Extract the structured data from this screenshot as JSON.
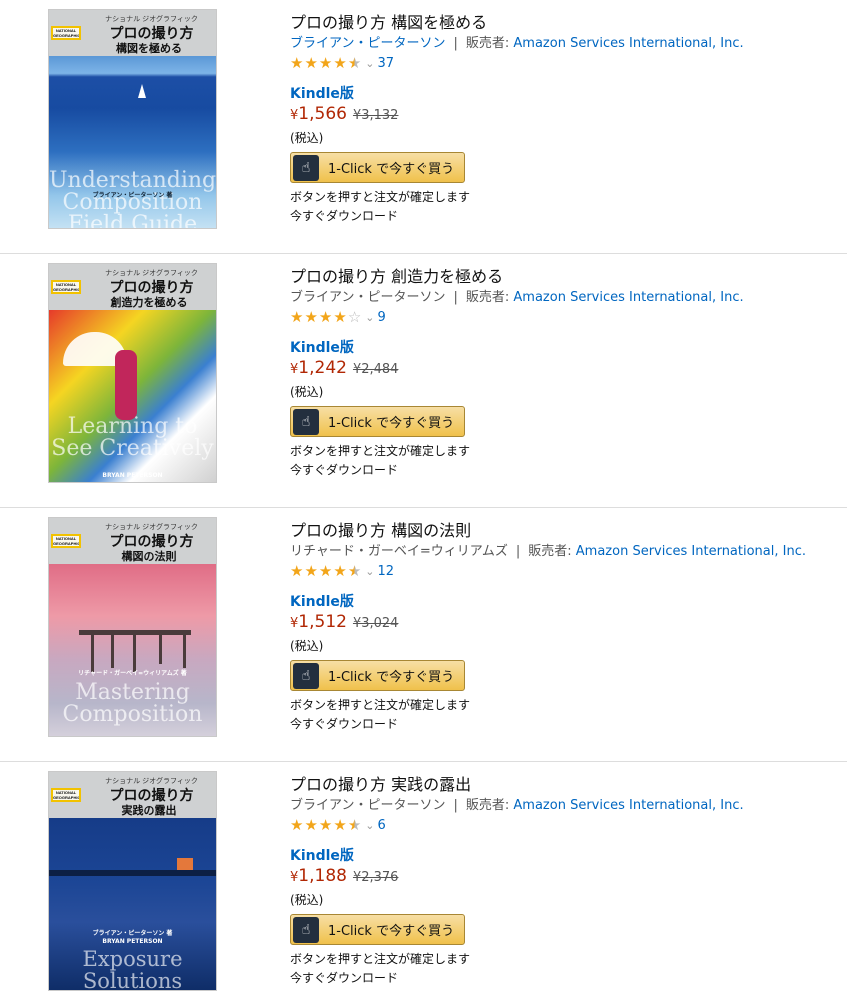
{
  "items": [
    {
      "title": "プロの撮り方 構図を極める",
      "author": "ブライアン・ピーターソン",
      "author_is_link": true,
      "seller_prefix": "販売者:",
      "seller": "Amazon Services International, Inc.",
      "stars": 4.5,
      "review_count": "37",
      "format": "Kindle版",
      "price": "1,566",
      "list_price": "¥3,132",
      "tax_note": "(税込)",
      "buy_label": "1-Click で今すぐ買う",
      "note": "ボタンを押すと注文が確定します",
      "download": "今すぐダウンロード",
      "cover": {
        "logo": "NATIONAL GEOGRAPHIC",
        "series_sub": "ナショナル ジオグラフィック",
        "series_main": "プロの撮り方",
        "subtitle": "構図を極める",
        "en_title": "Understanding Composition Field Guide",
        "author_ja": "ブライアン・ピーターソン 著",
        "author_en": "BRYAN PETERSON"
      }
    },
    {
      "title": "プロの撮り方 創造力を極める",
      "author": "ブライアン・ピーターソン",
      "author_is_link": false,
      "seller_prefix": "販売者:",
      "seller": "Amazon Services International, Inc.",
      "stars": 4,
      "review_count": "9",
      "format": "Kindle版",
      "price": "1,242",
      "list_price": "¥2,484",
      "tax_note": "(税込)",
      "buy_label": "1-Click で今すぐ買う",
      "note": "ボタンを押すと注文が確定します",
      "download": "今すぐダウンロード",
      "cover": {
        "logo": "NATIONAL GEOGRAPHIC",
        "series_sub": "ナショナル ジオグラフィック",
        "series_main": "プロの撮り方",
        "subtitle": "創造力を極める",
        "en_title": "Learning to See Creatively",
        "author_ja": "",
        "author_en": "BRYAN PETERSON"
      }
    },
    {
      "title": "プロの撮り方 構図の法則",
      "author": "リチャード・ガーベイ=ウィリアムズ",
      "author_is_link": false,
      "seller_prefix": "販売者:",
      "seller": "Amazon Services International, Inc.",
      "stars": 4.5,
      "review_count": "12",
      "format": "Kindle版",
      "price": "1,512",
      "list_price": "¥3,024",
      "tax_note": "(税込)",
      "buy_label": "1-Click で今すぐ買う",
      "note": "ボタンを押すと注文が確定します",
      "download": "今すぐダウンロード",
      "cover": {
        "logo": "NATIONAL GEOGRAPHIC",
        "series_sub": "ナショナル ジオグラフィック",
        "series_main": "プロの撮り方",
        "subtitle": "構図の法則",
        "en_title": "Mastering Composition",
        "author_ja": "リチャード・ガーベイ=ウィリアムズ 著",
        "author_en": ""
      }
    },
    {
      "title": "プロの撮り方 実践の露出",
      "author": "ブライアン・ピーターソン",
      "author_is_link": false,
      "seller_prefix": "販売者:",
      "seller": "Amazon Services International, Inc.",
      "stars": 4.5,
      "review_count": "6",
      "format": "Kindle版",
      "price": "1,188",
      "list_price": "¥2,376",
      "tax_note": "(税込)",
      "buy_label": "1-Click で今すぐ買う",
      "note": "ボタンを押すと注文が確定します",
      "download": "今すぐダウンロード",
      "cover": {
        "logo": "NATIONAL GEOGRAPHIC",
        "series_sub": "ナショナル ジオグラフィック",
        "series_main": "プロの撮り方",
        "subtitle": "実践の露出",
        "en_title": "Exposure Solutions",
        "author_ja": "ブライアン・ピーターソン 著",
        "author_en": "BRYAN PETERSON"
      }
    }
  ],
  "currency_symbol": "¥",
  "icons": {
    "rating_chevron": "chevron-down-icon",
    "buy_button": "tap-hand-icon"
  },
  "colors": {
    "link": "#0066c0",
    "price": "#b12704",
    "star": "#f2a51a",
    "button_top": "#f7dfa5",
    "button_bottom": "#f0c14b"
  }
}
